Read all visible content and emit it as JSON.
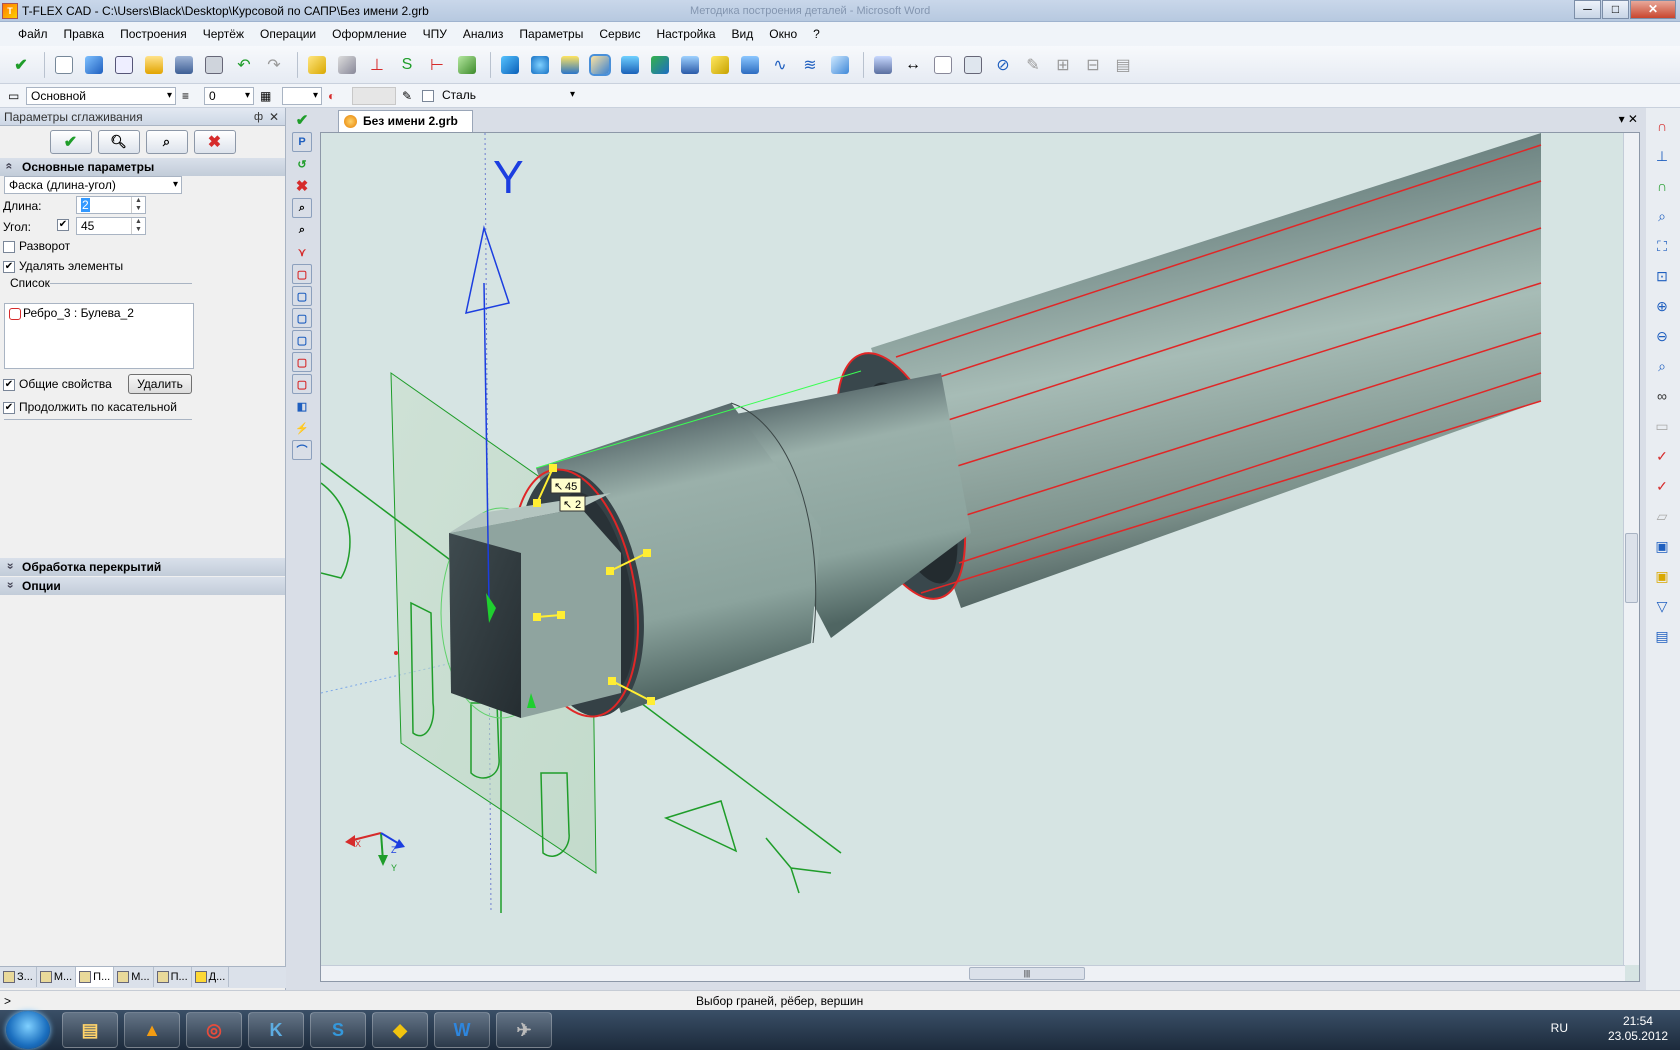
{
  "window": {
    "title": "T-FLEX CAD - C:\\Users\\Black\\Desktop\\Курсовой по САПР\\Без имени 2.grb",
    "background_title": "Методика построения деталей - Microsoft Word",
    "minimize": "─",
    "maximize": "□",
    "close": "✕"
  },
  "menu": [
    "Файл",
    "Правка",
    "Построения",
    "Чертёж",
    "Операции",
    "Оформление",
    "ЧПУ",
    "Анализ",
    "Параметры",
    "Сервис",
    "Настройка",
    "Вид",
    "Окно",
    "?"
  ],
  "toolbar2": {
    "layer": "Основной",
    "level": "0",
    "material_checkbox": false,
    "material": "Сталь"
  },
  "panel": {
    "title": "Параметры сглаживания",
    "pin": "ф",
    "close": "✕",
    "ok_icon": "✔",
    "cancel_icon": "✖",
    "section_main": "Основные параметры",
    "chamfer_type": "Фаска (длина-угол)",
    "length_label": "Длина:",
    "length_value": "2",
    "angle_label": "Угол:",
    "angle_checked": true,
    "angle_value": "45",
    "reverse_label": "Разворот",
    "reverse_checked": false,
    "delete_elements_label": "Удалять элементы",
    "delete_elements_checked": true,
    "list_label": "Список",
    "list_items": [
      "Ребро_3 : Булева_2"
    ],
    "common_props_label": "Общие свойства",
    "common_props_checked": true,
    "delete_button": "Удалить",
    "tangent_label": "Продолжить по касательной",
    "tangent_checked": true,
    "section_overlap": "Обработка перекрытий",
    "section_options": "Опции"
  },
  "bottom_tabs": [
    "З...",
    "М...",
    "П...",
    "М...",
    "П...",
    "Д..."
  ],
  "document": {
    "tab": "Без имени 2.grb",
    "controls": "▾ ✕"
  },
  "viewport": {
    "axis_y": "Y",
    "dim_angle": "45",
    "dim_length": "2",
    "triad_x": "X",
    "triad_y": "Y",
    "triad_z": "Z"
  },
  "status": {
    "prompt": ">",
    "message": "Выбор граней, рёбер, вершин"
  },
  "taskbar": {
    "lang": "RU",
    "time": "21:54",
    "date": "23.05.2012"
  },
  "colors": {
    "accent": "#d62b2b",
    "selection": "#ffee33",
    "construction": "#1f9d2a",
    "axis": "#1c3ee0"
  }
}
